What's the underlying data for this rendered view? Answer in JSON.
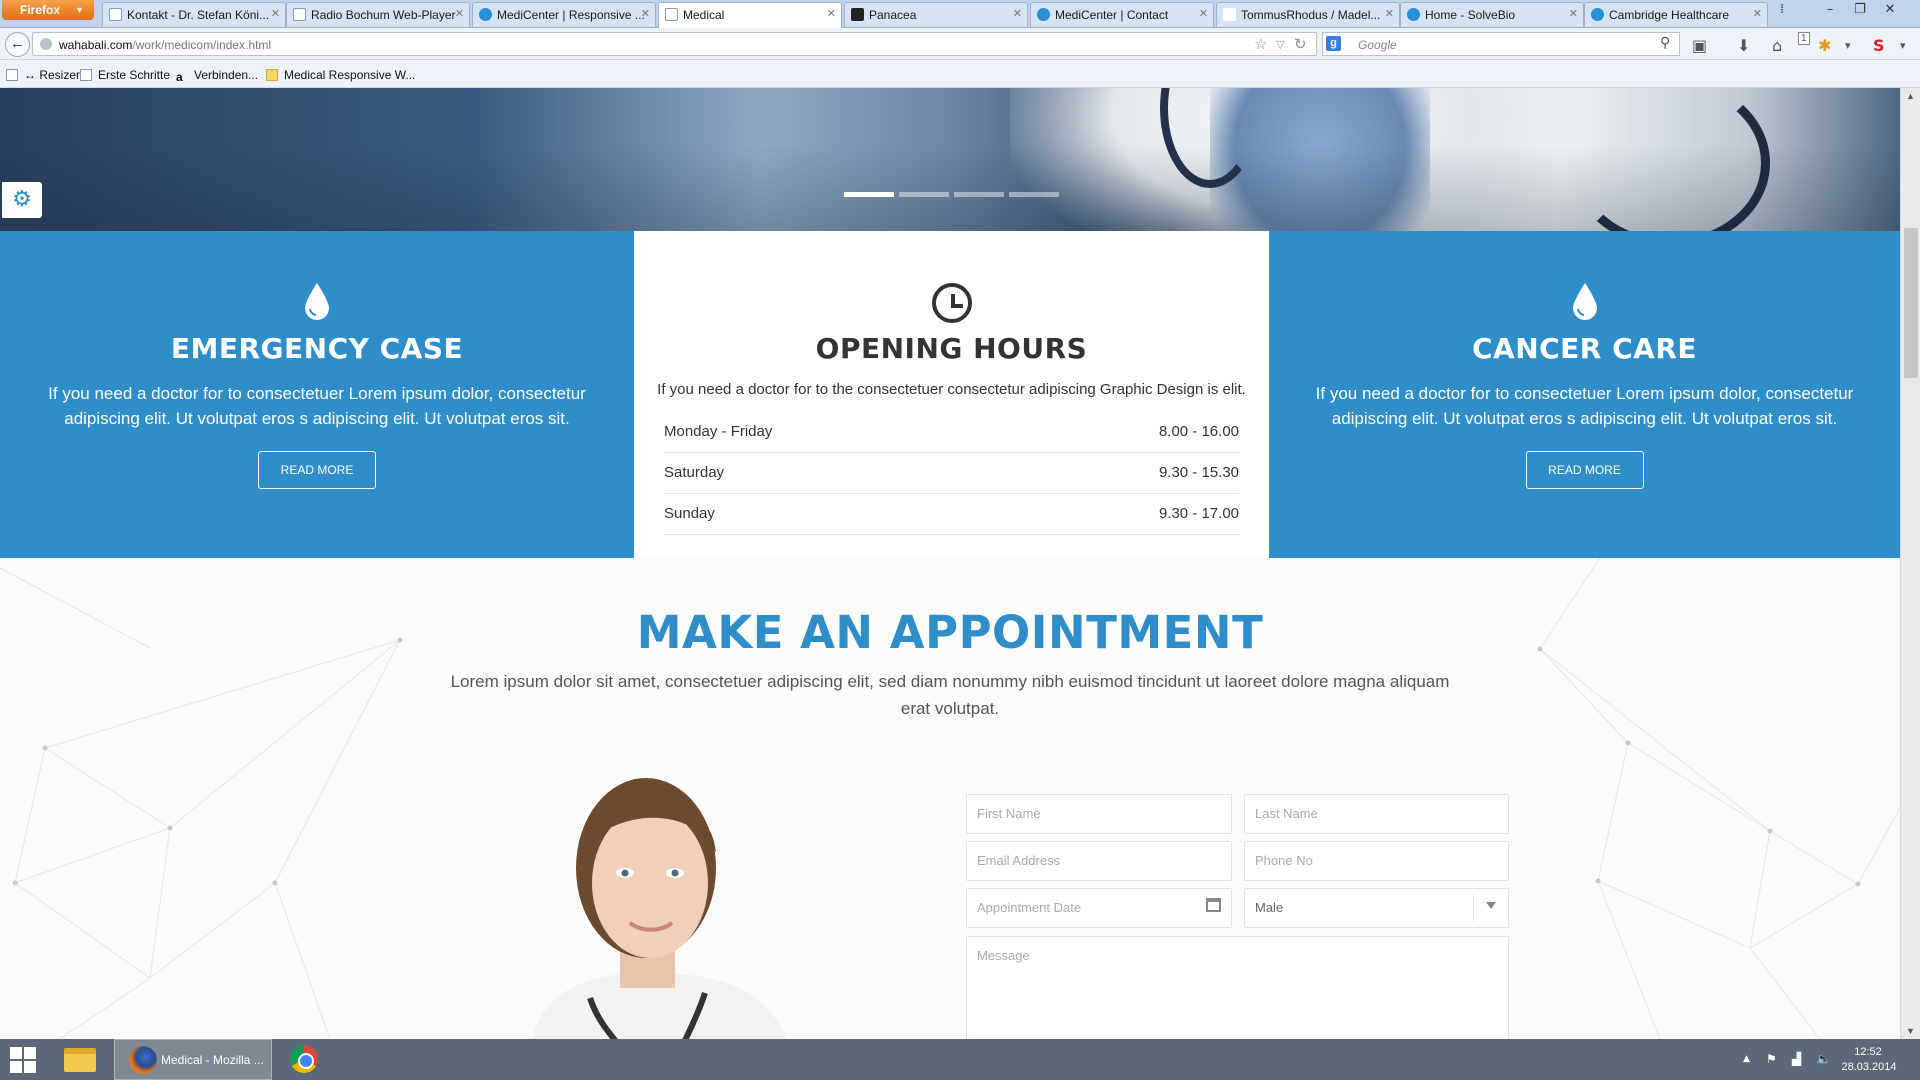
{
  "browser": {
    "menu_button": "Firefox",
    "tabs": [
      {
        "label": "Kontakt - Dr. Stefan Köni...",
        "icon": "page-icon",
        "active": false
      },
      {
        "label": "Radio Bochum Web-Player",
        "icon": "page-icon",
        "active": false
      },
      {
        "label": "MediCenter | Responsive ...",
        "icon": "medicenter-icon",
        "active": false
      },
      {
        "label": "Medical",
        "icon": "page-icon",
        "active": true
      },
      {
        "label": "Panacea",
        "icon": "panacea-icon",
        "active": false
      },
      {
        "label": "MediCenter | Contact",
        "icon": "medicenter-icon",
        "active": false
      },
      {
        "label": "TommusRhodus / Madel...",
        "icon": "tommus-icon",
        "active": false
      },
      {
        "label": "Home - SolveBio",
        "icon": "solvebio-icon",
        "active": false
      },
      {
        "label": "Cambridge Healthcare",
        "icon": "cambridge-icon",
        "active": false
      }
    ],
    "url_host": "wahabali.com",
    "url_path": "/work/medicom/index.html",
    "search_placeholder": "Google",
    "search_engine_icon": "g",
    "notification_count": "1",
    "bookmarks": [
      {
        "label": "↔ Resizer",
        "icon": "page-icon"
      },
      {
        "label": "Erste Schritte",
        "icon": "page-icon"
      },
      {
        "label": "Verbinden...",
        "icon": "amazon-icon"
      },
      {
        "label": "Medical Responsive W...",
        "icon": "folder-icon"
      }
    ]
  },
  "colors": {
    "accent": "#2f8dc9",
    "text_dark": "#333333",
    "taskbar": "#5a6878"
  },
  "hero": {
    "slider_dots": [
      true,
      false,
      false,
      false
    ]
  },
  "services": {
    "emergency": {
      "title": "EMERGENCY CASE",
      "text": "If you need a doctor for to consectetuer Lorem ipsum dolor, consectetur adipiscing elit. Ut volutpat eros s adipiscing elit. Ut volutpat eros sit.",
      "button": "READ MORE"
    },
    "hours": {
      "title": "OPENING HOURS",
      "text": "If you need a doctor for to the consectetuer consectetur adipiscing Graphic Design is elit.",
      "rows": [
        {
          "day": "Monday - Friday",
          "time": "8.00 - 16.00"
        },
        {
          "day": "Saturday",
          "time": "9.30 - 15.30"
        },
        {
          "day": "Sunday",
          "time": "9.30 - 17.00"
        }
      ]
    },
    "cancer": {
      "title": "CANCER CARE",
      "text": "If you need a doctor for to consectetuer Lorem ipsum dolor, consectetur adipiscing elit. Ut volutpat eros s adipiscing elit. Ut volutpat eros sit.",
      "button": "READ MORE"
    }
  },
  "appointment": {
    "title": "MAKE AN APPOINTMENT",
    "text": "Lorem ipsum dolor sit amet, consectetuer adipiscing elit, sed diam nonummy nibh euismod tincidunt ut laoreet dolore magna aliquam erat volutpat.",
    "form": {
      "first_name": "First Name",
      "last_name": "Last Name",
      "email": "Email Address",
      "phone": "Phone No",
      "date": "Appointment Date",
      "gender": "Male",
      "message": "Message"
    }
  },
  "taskbar": {
    "firefox_label": "Medical - Mozilla ...",
    "time": "12:52",
    "date": "28.03.2014"
  }
}
